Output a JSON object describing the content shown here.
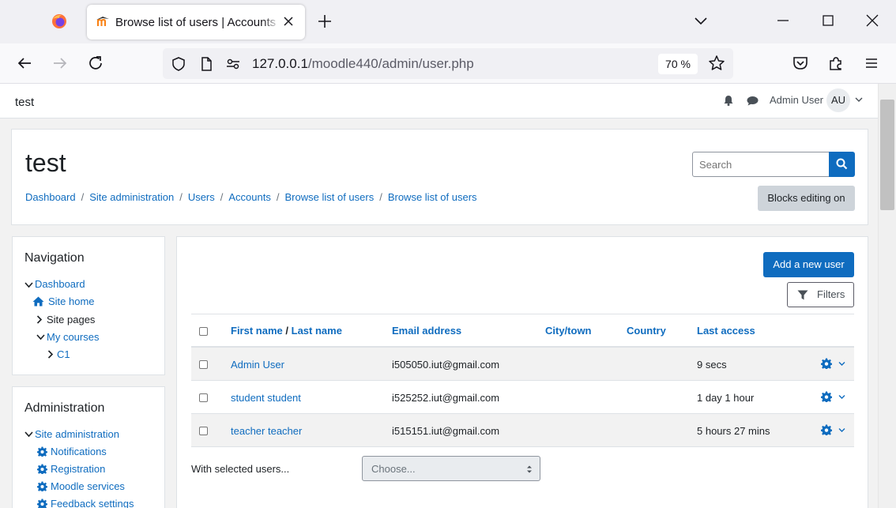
{
  "browser": {
    "tab_title": "Browse list of users | Accounts | test",
    "url_host": "127.0.0.1",
    "url_path": "/moodle440/admin/user.php",
    "zoom": "70 %"
  },
  "topnav": {
    "site_name": "test",
    "user_name": "Admin User",
    "avatar_initials": "AU"
  },
  "header": {
    "heading": "test",
    "breadcrumb": [
      "Dashboard",
      "Site administration",
      "Users",
      "Accounts",
      "Browse list of users",
      "Browse list of users"
    ],
    "search_placeholder": "Search",
    "blocks_editing": "Blocks editing on"
  },
  "navigation": {
    "title": "Navigation",
    "dashboard": "Dashboard",
    "site_home": "Site home",
    "site_pages": "Site pages",
    "my_courses": "My courses",
    "course_c1": "C1"
  },
  "administration": {
    "title": "Administration",
    "site_admin": "Site administration",
    "items": [
      "Notifications",
      "Registration",
      "Moodle services",
      "Feedback settings"
    ]
  },
  "main": {
    "add_user": "Add a new user",
    "filters": "Filters",
    "columns": {
      "first_name": "First name",
      "slash": "/",
      "last_name": "Last name",
      "email": "Email address",
      "city": "City/town",
      "country": "Country",
      "last_access": "Last access"
    },
    "rows": [
      {
        "name": "Admin User",
        "email": "i505050.iut@gmail.com",
        "city": "",
        "country": "",
        "last_access": "9 secs"
      },
      {
        "name": "student student",
        "email": "i525252.iut@gmail.com",
        "city": "",
        "country": "",
        "last_access": "1 day 1 hour"
      },
      {
        "name": "teacher teacher",
        "email": "i515151.iut@gmail.com",
        "city": "",
        "country": "",
        "last_access": "5 hours 27 mins"
      }
    ],
    "with_selected": "With selected users...",
    "choose": "Choose..."
  },
  "colors": {
    "link": "#0f6cbf",
    "primary_button": "#0f6cbf",
    "secondary_button": "#ced4da"
  }
}
